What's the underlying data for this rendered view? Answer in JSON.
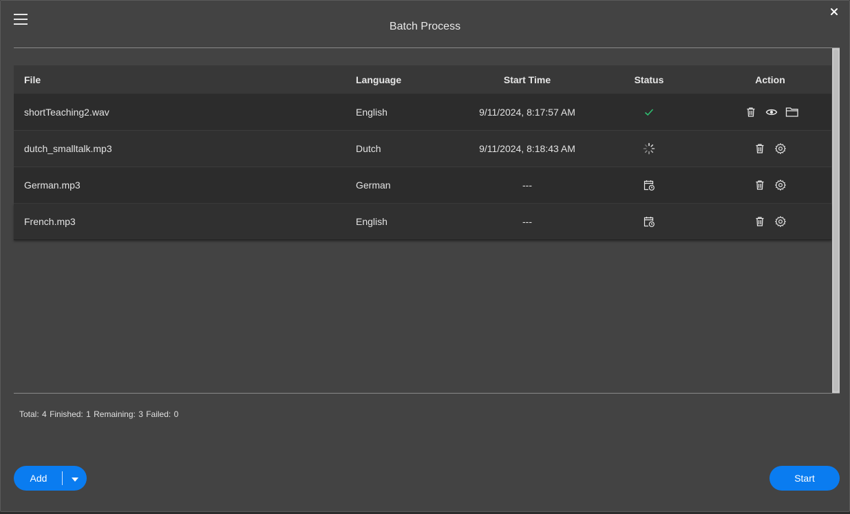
{
  "window": {
    "title": "Batch Process"
  },
  "table": {
    "headers": {
      "file": "File",
      "language": "Language",
      "start_time": "Start Time",
      "status": "Status",
      "action": "Action"
    },
    "rows": [
      {
        "file": "shortTeaching2.wav",
        "language": "English",
        "start_time": "9/11/2024, 8:17:57 AM",
        "status_icon": "check-icon",
        "actions": [
          "delete-icon",
          "view-icon",
          "folder-icon"
        ]
      },
      {
        "file": "dutch_smalltalk.mp3",
        "language": "Dutch",
        "start_time": "9/11/2024, 8:18:43 AM",
        "status_icon": "spinner-icon",
        "actions": [
          "delete-icon",
          "settings-icon"
        ]
      },
      {
        "file": "German.mp3",
        "language": "German",
        "start_time": "---",
        "status_icon": "scheduled-icon",
        "actions": [
          "delete-icon",
          "settings-icon"
        ]
      },
      {
        "file": "French.mp3",
        "language": "English",
        "start_time": "---",
        "status_icon": "scheduled-icon",
        "actions": [
          "delete-icon",
          "settings-icon"
        ]
      }
    ]
  },
  "stats": {
    "total_label": "Total:",
    "total": "4",
    "finished_label": "Finished:",
    "finished": "1",
    "remaining_label": "Remaining:",
    "remaining": "3",
    "failed_label": "Failed:",
    "failed": "0"
  },
  "buttons": {
    "add": "Add",
    "start": "Start"
  },
  "colors": {
    "accent": "#0a7cf0",
    "success": "#2fbf71",
    "background": "#434343"
  }
}
